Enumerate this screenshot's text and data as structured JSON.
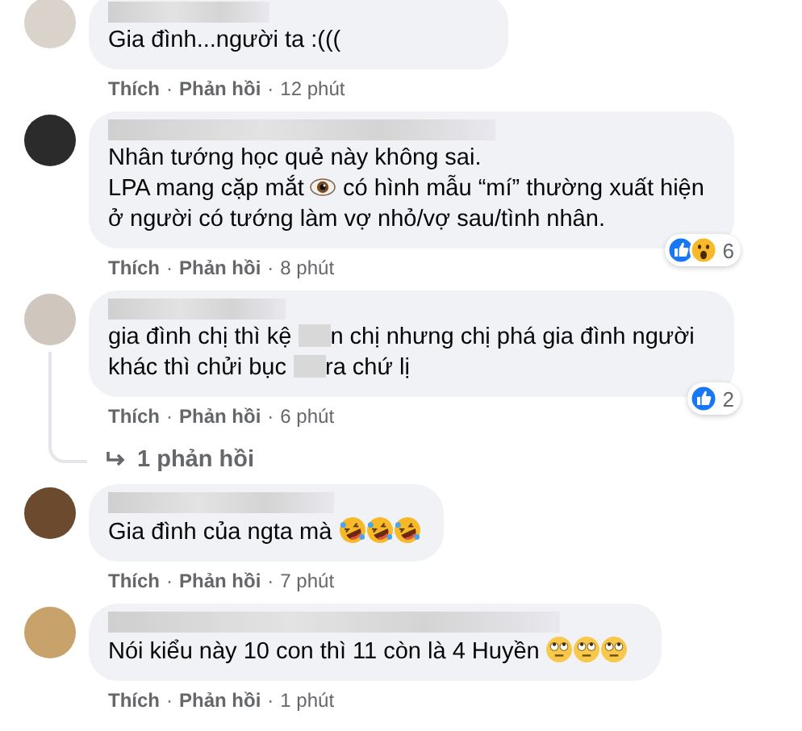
{
  "comments": [
    {
      "lines": [
        [
          {
            "kind": "text",
            "text": "Gia đình...người ta :((("
          }
        ]
      ],
      "meta": [
        {
          "kind": "action",
          "text": "Thích"
        },
        {
          "kind": "dot",
          "text": "·"
        },
        {
          "kind": "action",
          "text": "Phản hồi"
        },
        {
          "kind": "dot",
          "text": "·"
        },
        {
          "kind": "time",
          "text": "12 phút"
        }
      ]
    },
    {
      "lines": [
        [
          {
            "kind": "text",
            "text": "Nhân tướng học quẻ này không sai."
          }
        ],
        [
          {
            "kind": "text",
            "text": "LPA mang cặp mắt "
          },
          {
            "kind": "eye"
          },
          {
            "kind": "text",
            "text": " có hình mẫu “mí” thường xuất hiện ở người có tướng làm vợ nhỏ/vợ sau/tình nhân."
          }
        ]
      ],
      "meta": [
        {
          "kind": "action",
          "text": "Thích"
        },
        {
          "kind": "dot",
          "text": "·"
        },
        {
          "kind": "action",
          "text": "Phản hồi"
        },
        {
          "kind": "dot",
          "text": "·"
        },
        {
          "kind": "time",
          "text": "8 phút"
        }
      ],
      "reactions": {
        "icons": [
          {
            "kind": "like"
          },
          {
            "kind": "wow"
          }
        ],
        "count": "6"
      }
    },
    {
      "lines": [
        [
          {
            "kind": "text",
            "text": "gia đình chị thì kệ "
          },
          {
            "kind": "redacted"
          },
          {
            "kind": "text",
            "text": "n chị nhưng chị phá gia đình người khác thì chửi bục "
          },
          {
            "kind": "redacted"
          },
          {
            "kind": "text",
            "text": "ra chứ lị"
          }
        ]
      ],
      "meta": [
        {
          "kind": "action",
          "text": "Thích"
        },
        {
          "kind": "dot",
          "text": "·"
        },
        {
          "kind": "action",
          "text": "Phản hồi"
        },
        {
          "kind": "dot",
          "text": "·"
        },
        {
          "kind": "time",
          "text": "6 phút"
        }
      ],
      "reactions": {
        "icons": [
          {
            "kind": "like"
          }
        ],
        "count": "2"
      },
      "replies_link": "1 phản hồi"
    },
    {
      "lines": [
        [
          {
            "kind": "text",
            "text": "Gia đình của ngta mà "
          },
          {
            "kind": "laugh"
          },
          {
            "kind": "laugh"
          },
          {
            "kind": "laugh"
          }
        ]
      ],
      "meta": [
        {
          "kind": "action",
          "text": "Thích"
        },
        {
          "kind": "dot",
          "text": "·"
        },
        {
          "kind": "action",
          "text": "Phản hồi"
        },
        {
          "kind": "dot",
          "text": "·"
        },
        {
          "kind": "time",
          "text": "7 phút"
        }
      ]
    },
    {
      "lines": [
        [
          {
            "kind": "text",
            "text": "Nói kiểu này 10 con thì 11 còn là 4 Huyền "
          },
          {
            "kind": "eyeroll"
          },
          {
            "kind": "eyeroll"
          },
          {
            "kind": "eyeroll"
          }
        ]
      ],
      "meta": [
        {
          "kind": "action",
          "text": "Thích"
        },
        {
          "kind": "dot",
          "text": "·"
        },
        {
          "kind": "action",
          "text": "Phản hồi"
        },
        {
          "kind": "dot",
          "text": "·"
        },
        {
          "kind": "time",
          "text": "1 phút"
        }
      ]
    }
  ]
}
